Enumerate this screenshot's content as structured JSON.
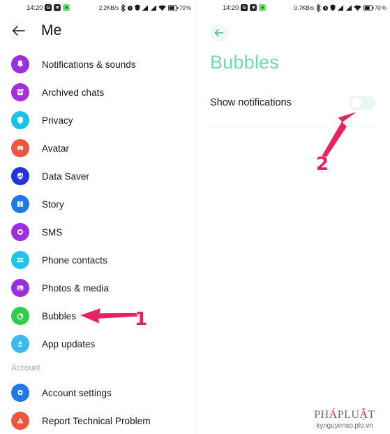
{
  "status_bar": {
    "time": "14:20",
    "app_icons": [
      {
        "name": "google-icon",
        "glyph": "G",
        "bg": "#1a1a1a"
      },
      {
        "name": "download-icon",
        "glyph": "▼",
        "bg": "#2b2b2b"
      },
      {
        "name": "green-app-icon",
        "glyph": "■",
        "bg": "#6fe06f"
      }
    ],
    "left_rate": "2.2KB/s",
    "right_rate": "0.7KB/s",
    "battery_percent": "70",
    "percent_symbol": "%",
    "icons": [
      "bluetooth-icon",
      "alarm-icon",
      "shield-icon",
      "signal-icon",
      "signal-icon-2",
      "wifi-icon",
      "battery-icon"
    ]
  },
  "left_panel": {
    "back_label": "←",
    "title": "Me",
    "items": [
      {
        "label": "Notifications & sounds",
        "icon": "bell-icon",
        "color": "#9b2fe0"
      },
      {
        "label": "Archived chats",
        "icon": "archive-icon",
        "color": "#a32fe0"
      },
      {
        "label": "Privacy",
        "icon": "shield-icon",
        "color": "#18c2e8"
      },
      {
        "label": "Avatar",
        "icon": "avatar-icon",
        "color": "#f0553d"
      },
      {
        "label": "Data Saver",
        "icon": "data-saver-icon",
        "color": "#2236d8"
      },
      {
        "label": "Story",
        "icon": "story-icon",
        "color": "#1f7ae8"
      },
      {
        "label": "SMS",
        "icon": "sms-icon",
        "color": "#9b2fe0"
      },
      {
        "label": "Phone contacts",
        "icon": "contacts-icon",
        "color": "#21c4e8"
      },
      {
        "label": "Photos & media",
        "icon": "photos-icon",
        "color": "#9b2fe0"
      },
      {
        "label": "Bubbles",
        "icon": "bubbles-icon",
        "color": "#2ecc49"
      },
      {
        "label": "App updates",
        "icon": "update-icon",
        "color": "#3bb9ee"
      }
    ],
    "section_label": "Account",
    "account_items": [
      {
        "label": "Account settings",
        "icon": "gear-icon",
        "color": "#1f7ae8"
      },
      {
        "label": "Report Technical Problem",
        "icon": "warning-icon",
        "color": "#f0553d"
      }
    ]
  },
  "right_panel": {
    "back_label": "←",
    "title": "Bubbles",
    "title_color": "#6fdcad",
    "setting_label": "Show notifications",
    "toggle_state": "off"
  },
  "annotations": [
    {
      "number": "1",
      "target": "bubbles-row",
      "color": "#e91e63"
    },
    {
      "number": "2",
      "target": "show-notifications-toggle",
      "color": "#e91e63"
    }
  ],
  "watermark": {
    "brand_part1": "PH",
    "brand_accent": "Á",
    "brand_part2": "PLU",
    "brand_accent2": "Ậ",
    "brand_part3": "T",
    "site": "kynguyenso.plo.vn"
  }
}
